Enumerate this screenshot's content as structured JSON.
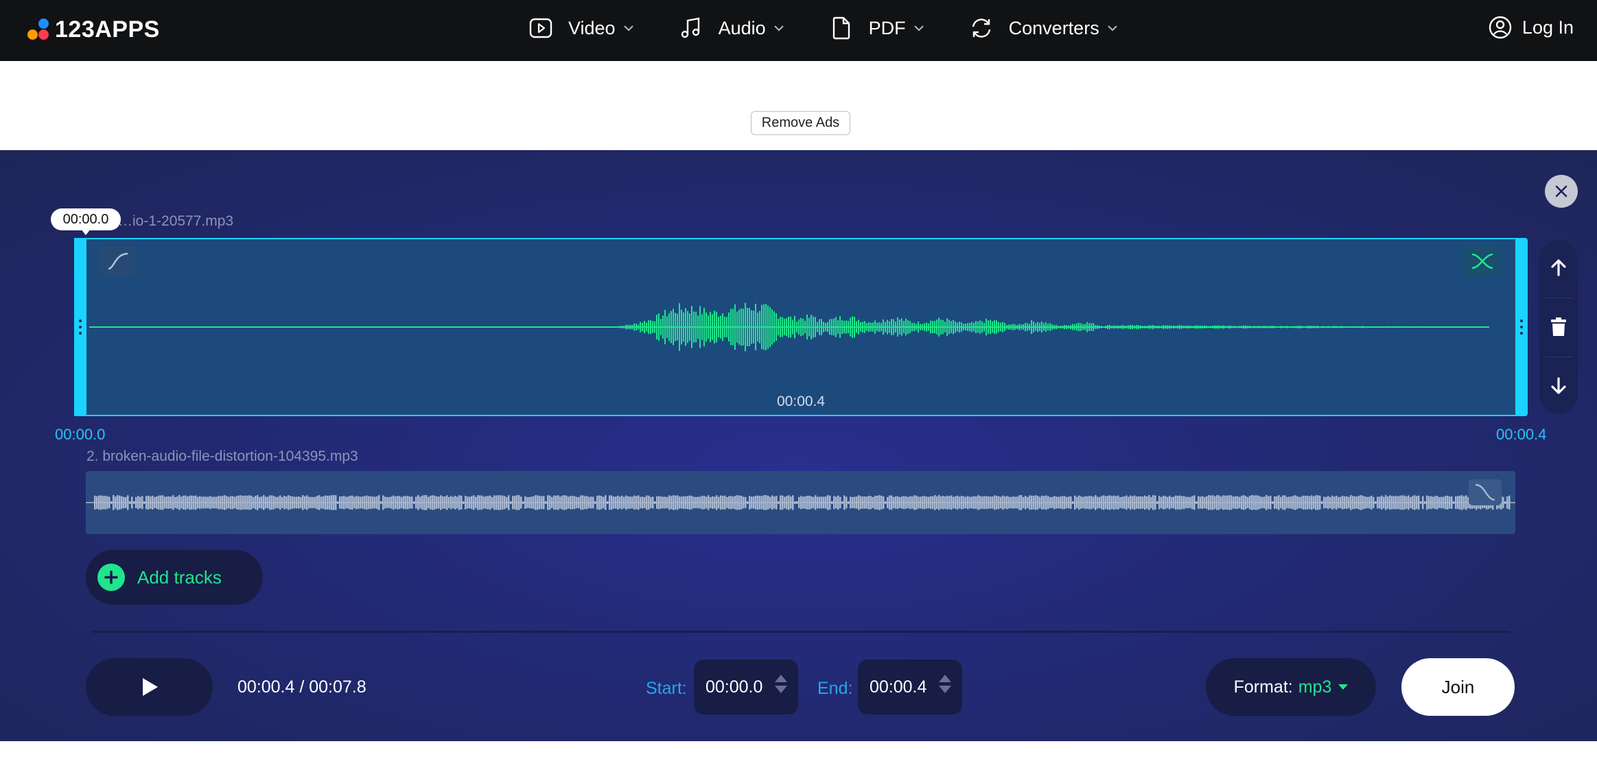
{
  "brand": {
    "name": "123APPS"
  },
  "nav": {
    "items": [
      {
        "label": "Video",
        "icon": "video-icon"
      },
      {
        "label": "Audio",
        "icon": "music-note-icon"
      },
      {
        "label": "PDF",
        "icon": "document-icon"
      },
      {
        "label": "Converters",
        "icon": "convert-icon"
      }
    ],
    "login_label": "Log In"
  },
  "ads": {
    "remove_label": "Remove Ads"
  },
  "tracks": [
    {
      "file_label": "…io-1-20577.mp3",
      "position_bubble": "00:00.0",
      "center_time": "00:00.4",
      "start_edge": "00:00.0",
      "end_edge": "00:00.4"
    },
    {
      "file_label": "2. broken-audio-file-distortion-104395.mp3"
    }
  ],
  "add_tracks_label": "Add tracks",
  "player": {
    "progress": "00:00.4 / 00:07.8",
    "start_label": "Start:",
    "start_value": "00:00.0",
    "end_label": "End:",
    "end_value": "00:00.4"
  },
  "format": {
    "label": "Format:",
    "value": "mp3"
  },
  "join_label": "Join",
  "colors": {
    "accent_green": "#1fe58d",
    "accent_cyan": "#1ad3ff",
    "editor_bg": "#232a77",
    "topbar_bg": "#111214"
  }
}
